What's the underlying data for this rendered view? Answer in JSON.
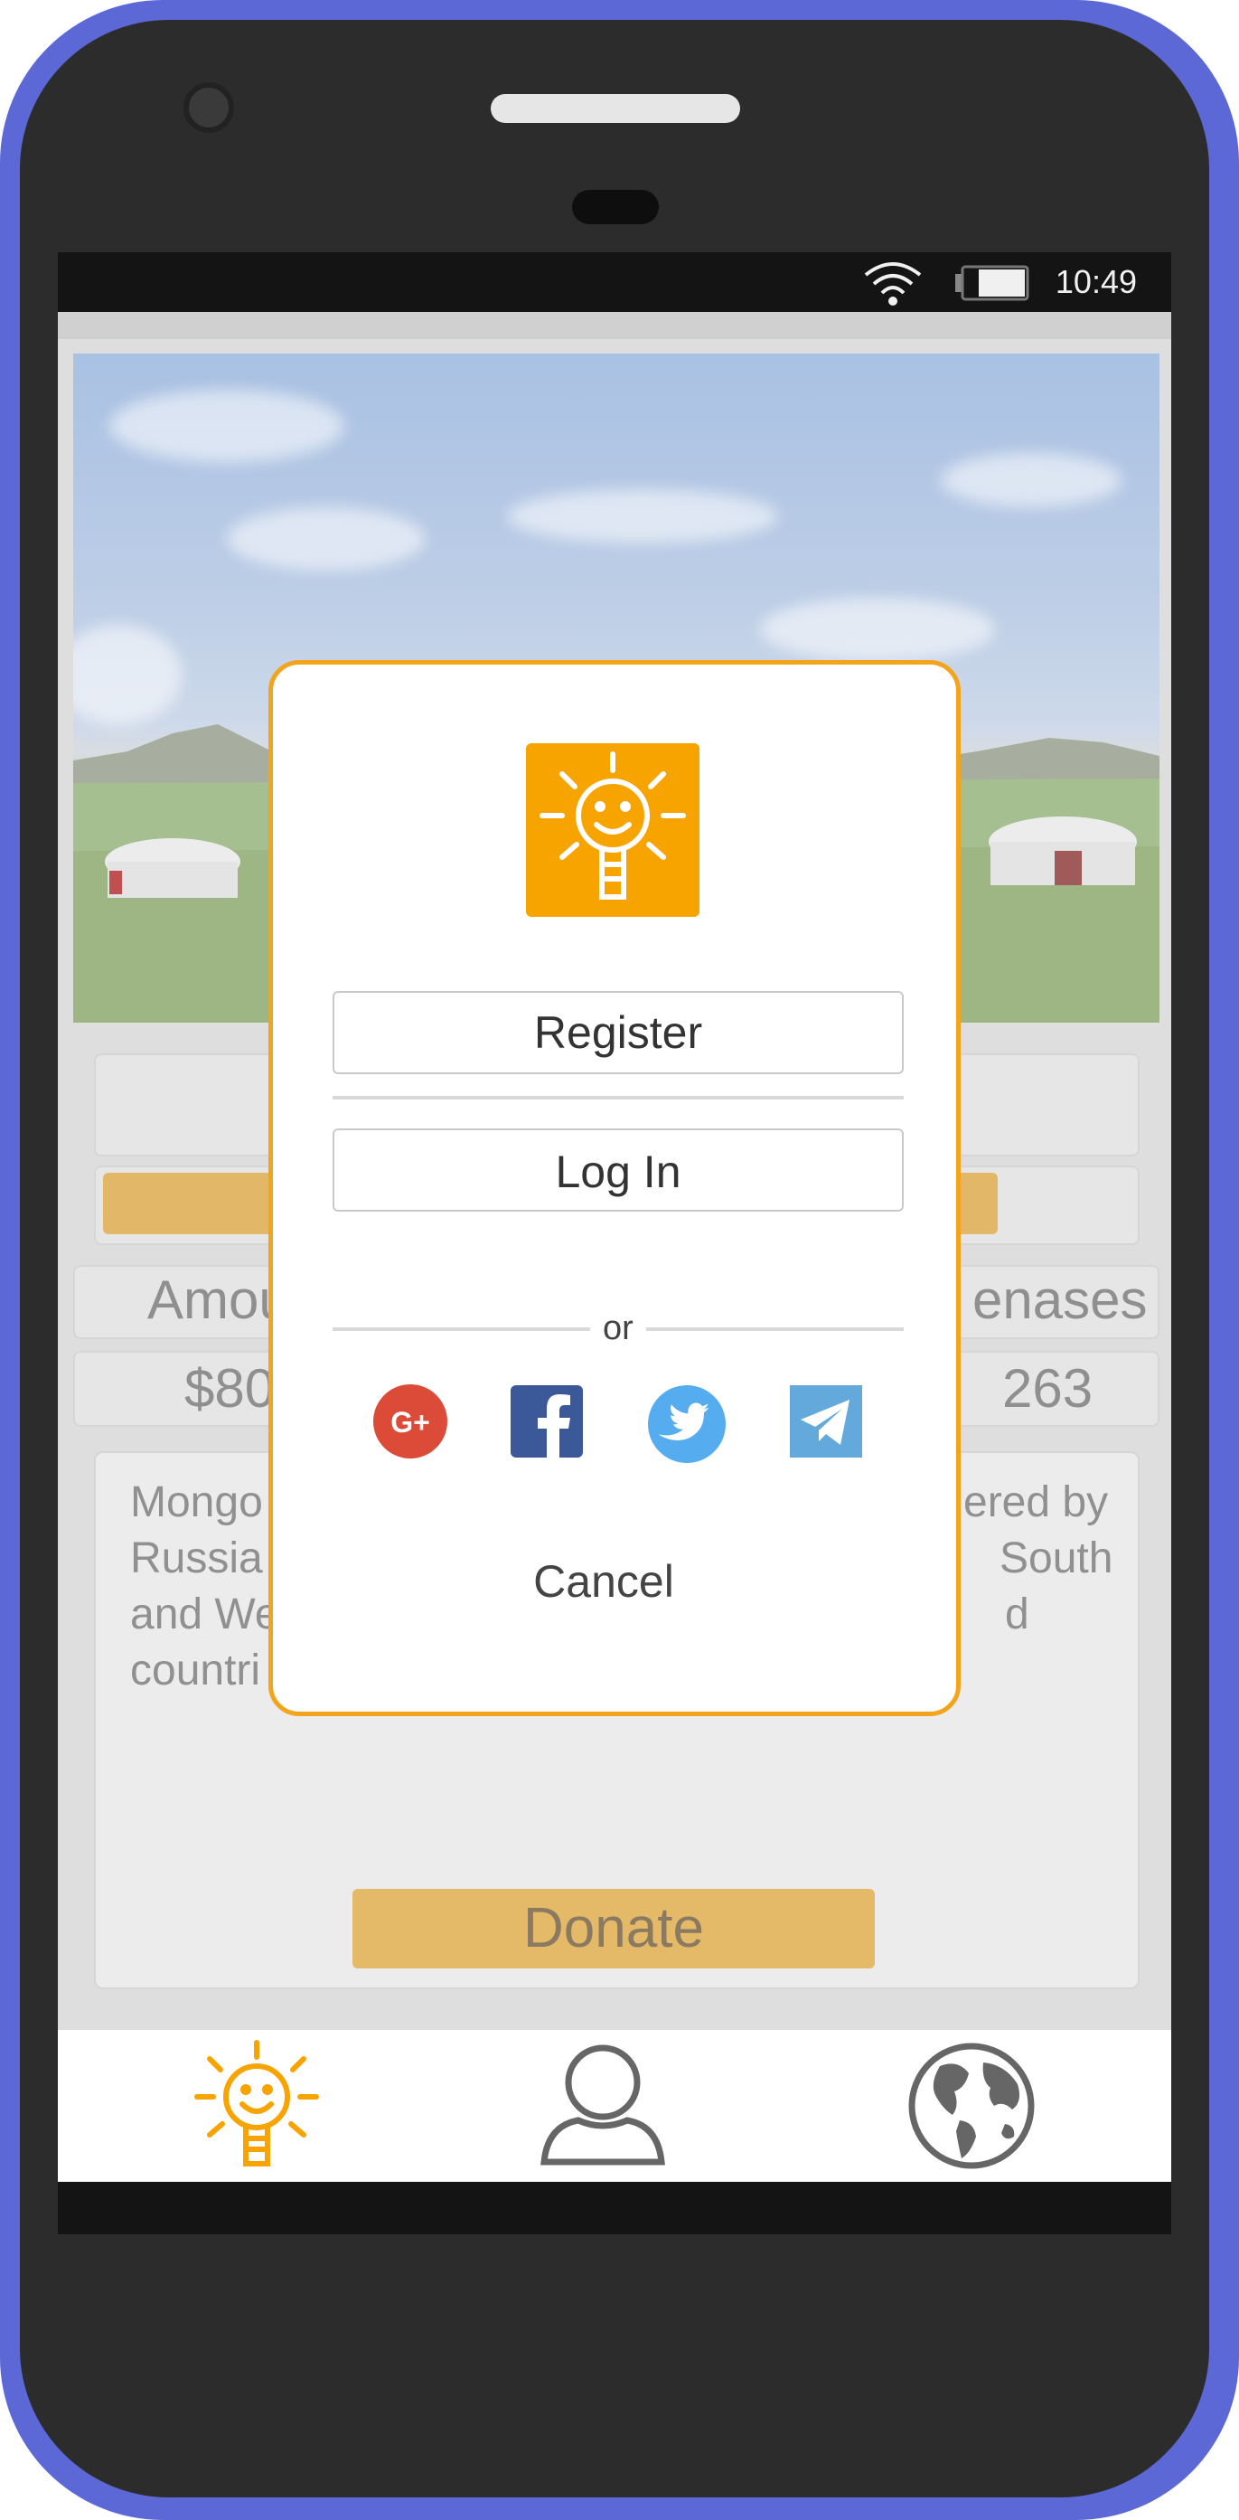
{
  "status_bar": {
    "time": "10:49",
    "wifi_icon": "wifi-icon",
    "battery_icon": "battery-icon"
  },
  "project": {
    "amount_label": "Amou",
    "amount_value": "$80",
    "right_label": "enases",
    "right_value": "263",
    "description_lines": [
      {
        "left": "Mongo",
        "right": "ered by"
      },
      {
        "left": "Russia",
        "right": "South"
      },
      {
        "left": "and We",
        "right": "d"
      },
      {
        "left": "countri",
        "right": ""
      }
    ],
    "donate_label": "Donate"
  },
  "modal": {
    "logo_icon": "sun-bulb-logo-icon",
    "register_label": "Register",
    "login_label": "Log In",
    "or_label": "or",
    "social": [
      {
        "name": "google-plus-icon",
        "color": "#dc4a38"
      },
      {
        "name": "facebook-icon",
        "color": "#3b5998"
      },
      {
        "name": "twitter-icon",
        "color": "#55acee"
      },
      {
        "name": "telegram-icon",
        "color": "#64a9dc"
      }
    ],
    "cancel_label": "Cancel",
    "accent_color": "#f3a41b"
  },
  "bottom_nav": [
    {
      "name": "nav-home",
      "icon": "sun-bulb-icon",
      "active": true
    },
    {
      "name": "nav-profile",
      "icon": "person-icon",
      "active": false
    },
    {
      "name": "nav-world",
      "icon": "globe-icon",
      "active": false
    }
  ],
  "colors": {
    "frame": "#5b68d6",
    "accent": "#f7a400"
  }
}
